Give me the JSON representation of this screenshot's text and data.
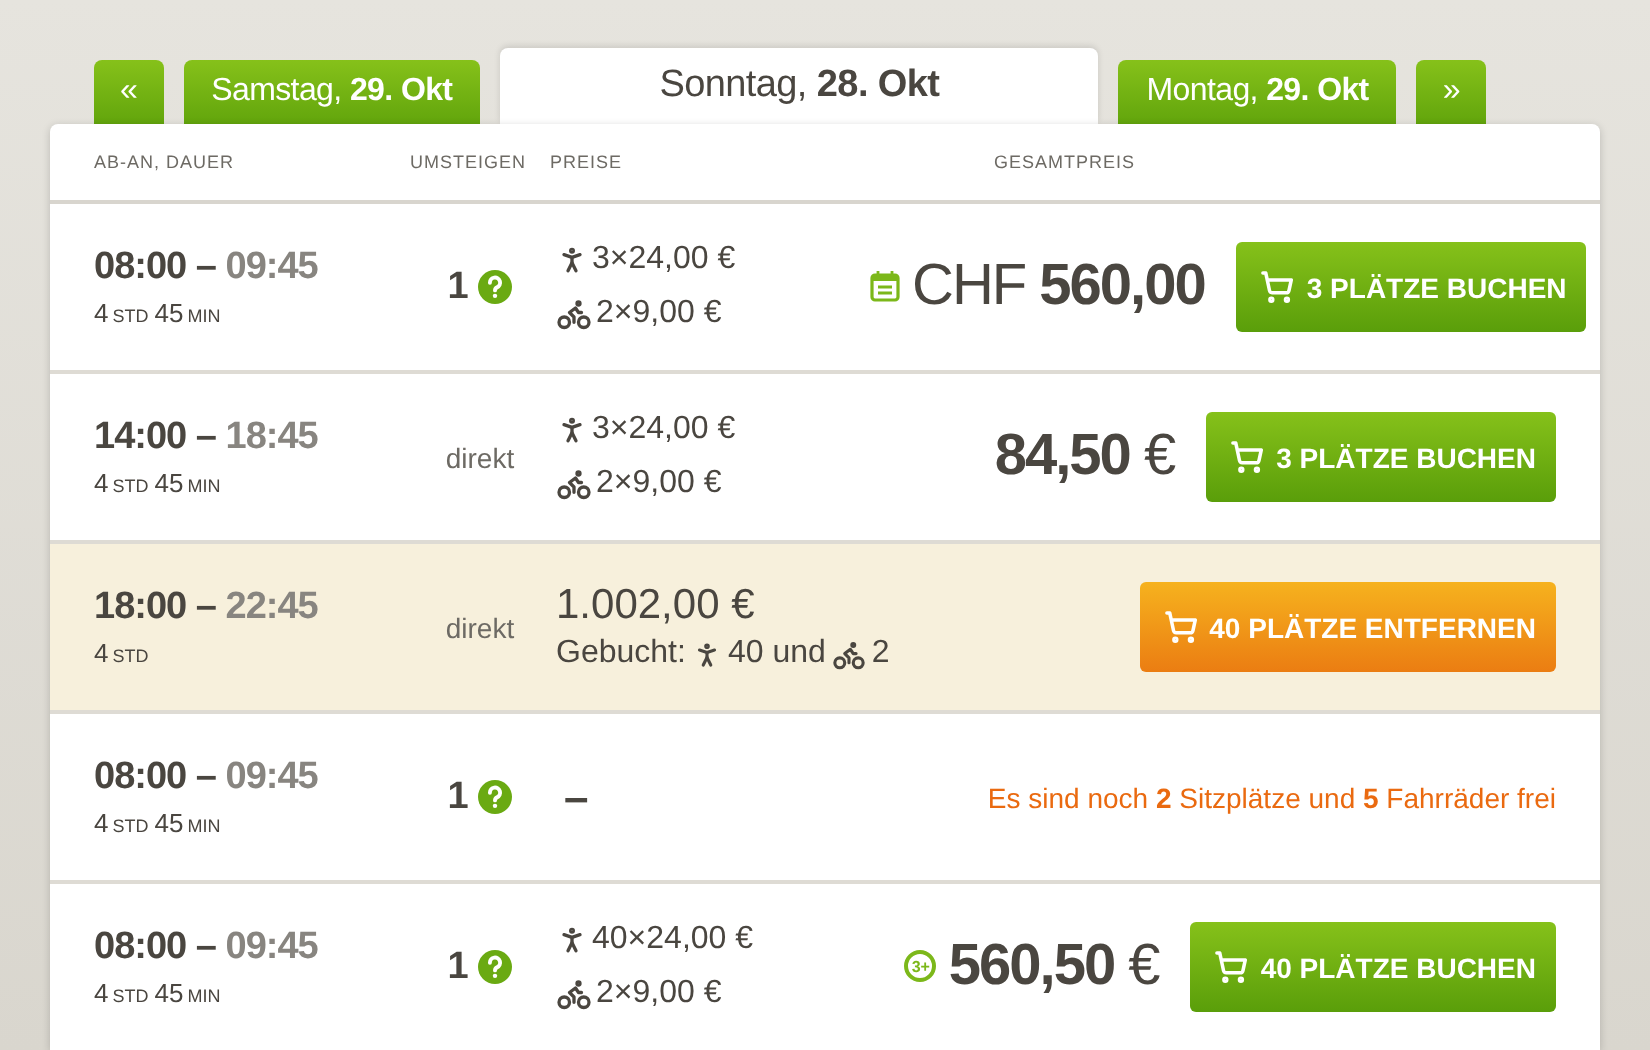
{
  "tabs": [
    {
      "label": "«",
      "selected": false
    },
    {
      "label": "Samstag, **29. Okt**",
      "selected": false
    },
    {
      "label": "Sonntag, **28. Okt**",
      "selected": true
    },
    {
      "label": "Montag, **29. Okt**",
      "selected": false
    },
    {
      "label": "»",
      "selected": false
    }
  ],
  "table": {
    "columns": [
      "AB-AN, DAUER",
      "UMSTEIGEN",
      "PREISE",
      "GESAMTPREIS"
    ],
    "rows": [
      {
        "kind": "offer",
        "from": "08:00",
        "dash": "–",
        "to": "09:45",
        "duration": [
          {
            "value": "4",
            "unit": "STD"
          },
          {
            "value": "45",
            "unit": "MIN"
          }
        ],
        "transfers": {
          "kind": "count",
          "text": "1"
        },
        "prices": [
          {
            "kind": "person",
            "text": "3×24,00 €"
          },
          {
            "kind": "bike",
            "text": "2×9,00 €"
          }
        ],
        "total": {
          "text": "CHF **560,00**",
          "marker": {
            "kind": "calendar"
          }
        },
        "button": {
          "kind": "book",
          "label": "3 PLÄTZE BUCHEN"
        }
      },
      {
        "kind": "offer",
        "from": "14:00",
        "dash": "–",
        "to": "18:45",
        "duration": [
          {
            "value": "4",
            "unit": "STD"
          },
          {
            "value": "45",
            "unit": "MIN"
          }
        ],
        "transfers": {
          "kind": "direct",
          "text": "direkt"
        },
        "prices": [
          {
            "kind": "person",
            "text": "3×24,00 €"
          },
          {
            "kind": "bike",
            "text": "2×9,00 €"
          }
        ],
        "total": {
          "text": "**84,50** €"
        },
        "button": {
          "kind": "book",
          "label": "3 PLÄTZE BUCHEN"
        }
      },
      {
        "kind": "booked",
        "from": "18:00",
        "dash": "–",
        "to": "22:45",
        "duration": [
          {
            "value": "4",
            "unit": "STD"
          }
        ],
        "transfers": {
          "kind": "direct",
          "text": "direkt"
        },
        "amount": "1.002,00 €",
        "booked": {
          "label": "Gebucht:",
          "persons": "40",
          "joiner": "und",
          "bikes": "2"
        },
        "button": {
          "kind": "remove",
          "label": "40 PLÄTZE ENTFERNEN"
        }
      },
      {
        "kind": "unavailable",
        "from": "08:00",
        "dash": "–",
        "to": "09:45",
        "duration": [
          {
            "value": "4",
            "unit": "STD"
          },
          {
            "value": "45",
            "unit": "MIN"
          }
        ],
        "transfers": {
          "kind": "count",
          "text": "1"
        },
        "no_price": "–",
        "notice": "Es sind noch **2** Sitzplätze und **5** Fahrräder frei"
      },
      {
        "kind": "offer",
        "from": "08:00",
        "dash": "–",
        "to": "09:45",
        "duration": [
          {
            "value": "4",
            "unit": "STD"
          },
          {
            "value": "45",
            "unit": "MIN"
          }
        ],
        "transfers": {
          "kind": "count",
          "text": "1"
        },
        "prices": [
          {
            "kind": "person",
            "text": "40×24,00 €"
          },
          {
            "kind": "bike",
            "text": "2×9,00 €"
          }
        ],
        "total": {
          "text": "**560,50** €",
          "marker": {
            "kind": "group",
            "label": "3+"
          }
        },
        "button": {
          "kind": "book",
          "label": "40 PLÄTZE BUCHEN"
        }
      }
    ]
  }
}
